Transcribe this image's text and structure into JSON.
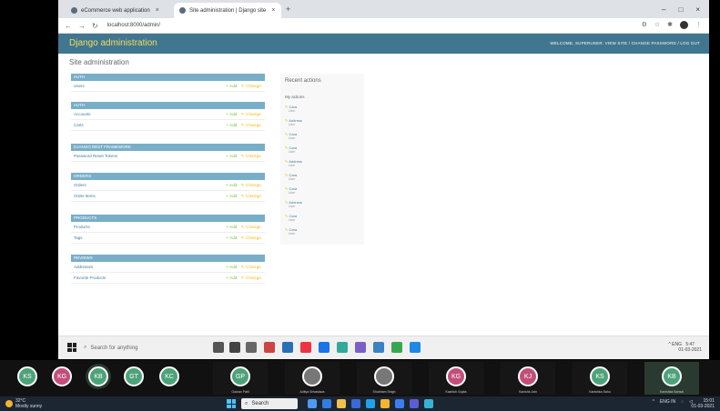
{
  "browser": {
    "tabs": [
      {
        "label": "eCommerce web application"
      },
      {
        "label": "Site administration | Django site"
      }
    ],
    "url": "localhost:8000/admin/",
    "window_controls": [
      "–",
      "□",
      "×"
    ]
  },
  "admin": {
    "brand": "Django administration",
    "user_tools": "WELCOME, SUPERUSER. VIEW SITE / CHANGE PASSWORD / LOG OUT",
    "page_title": "Site administration",
    "add_label": "+ Add",
    "change_label": "✎ Change",
    "modules": [
      {
        "caption": "AUTH",
        "rows": [
          {
            "name": "Users"
          }
        ]
      },
      {
        "caption": "AUTH",
        "rows": [
          {
            "name": "Accounts"
          },
          {
            "name": "Carts"
          }
        ]
      },
      {
        "caption": "DJANGO REST FRAMEWORK",
        "rows": [
          {
            "name": "Password Reset Tokens"
          }
        ]
      },
      {
        "caption": "ORDERS",
        "rows": [
          {
            "name": "Orders"
          },
          {
            "name": "Order Items"
          }
        ]
      },
      {
        "caption": "PRODUCTS",
        "rows": [
          {
            "name": "Products"
          },
          {
            "name": "Tags"
          }
        ]
      },
      {
        "caption": "REVIEWS",
        "rows": [
          {
            "name": "Addresses"
          },
          {
            "name": "Favorite Products"
          }
        ]
      }
    ],
    "recent": {
      "title": "Recent actions",
      "subtitle": "My actions",
      "items": [
        {
          "label": "Cara",
          "type": "User"
        },
        {
          "label": "Address",
          "type": "User"
        },
        {
          "label": "Cara",
          "type": "User"
        },
        {
          "label": "Cara",
          "type": "User"
        },
        {
          "label": "Address",
          "type": "User"
        },
        {
          "label": "Cara",
          "type": "User"
        },
        {
          "label": "Cara",
          "type": "User"
        },
        {
          "label": "Address",
          "type": "User"
        },
        {
          "label": "Cara",
          "type": "User"
        },
        {
          "label": "Cara",
          "type": "User"
        }
      ]
    }
  },
  "inner_taskbar": {
    "search_placeholder": "Search for anything",
    "tray_text": "^ ENG",
    "time": "5:47",
    "date": "01-03-2021"
  },
  "participants": [
    {
      "initials": "KS",
      "color": "#4ea27a",
      "name": ""
    },
    {
      "initials": "KG",
      "color": "#c14f7a",
      "name": ""
    },
    {
      "initials": "KB",
      "color": "#4ea27a",
      "name": ""
    },
    {
      "initials": "GT",
      "color": "#4ea27a",
      "name": ""
    },
    {
      "initials": "KC",
      "color": "#4ea27a",
      "name": ""
    },
    {
      "initials": "GP",
      "color": "#4ea27a",
      "name": "Gaurav Patil"
    },
    {
      "initials": "",
      "color": "#777777",
      "name": "Aditya Srivastava"
    },
    {
      "initials": "",
      "color": "#777777",
      "name": "Shubham Singh"
    },
    {
      "initials": "KG",
      "color": "#c14f7a",
      "name": "Kashish Gupta"
    },
    {
      "initials": "KJ",
      "color": "#c14f7a",
      "name": "Kanishk Jain"
    },
    {
      "initials": "KS",
      "color": "#4ea27a",
      "name": "Kanishka Sahu"
    },
    {
      "initials": "KB",
      "color": "#4ea27a",
      "name": "Kanishka Bansal"
    }
  ],
  "host_taskbar": {
    "weather_temp": "32°C",
    "weather_desc": "Mostly sunny",
    "search_label": "Search",
    "lang": "ENG IN",
    "time": "15:01",
    "date": "01-03-2021"
  }
}
